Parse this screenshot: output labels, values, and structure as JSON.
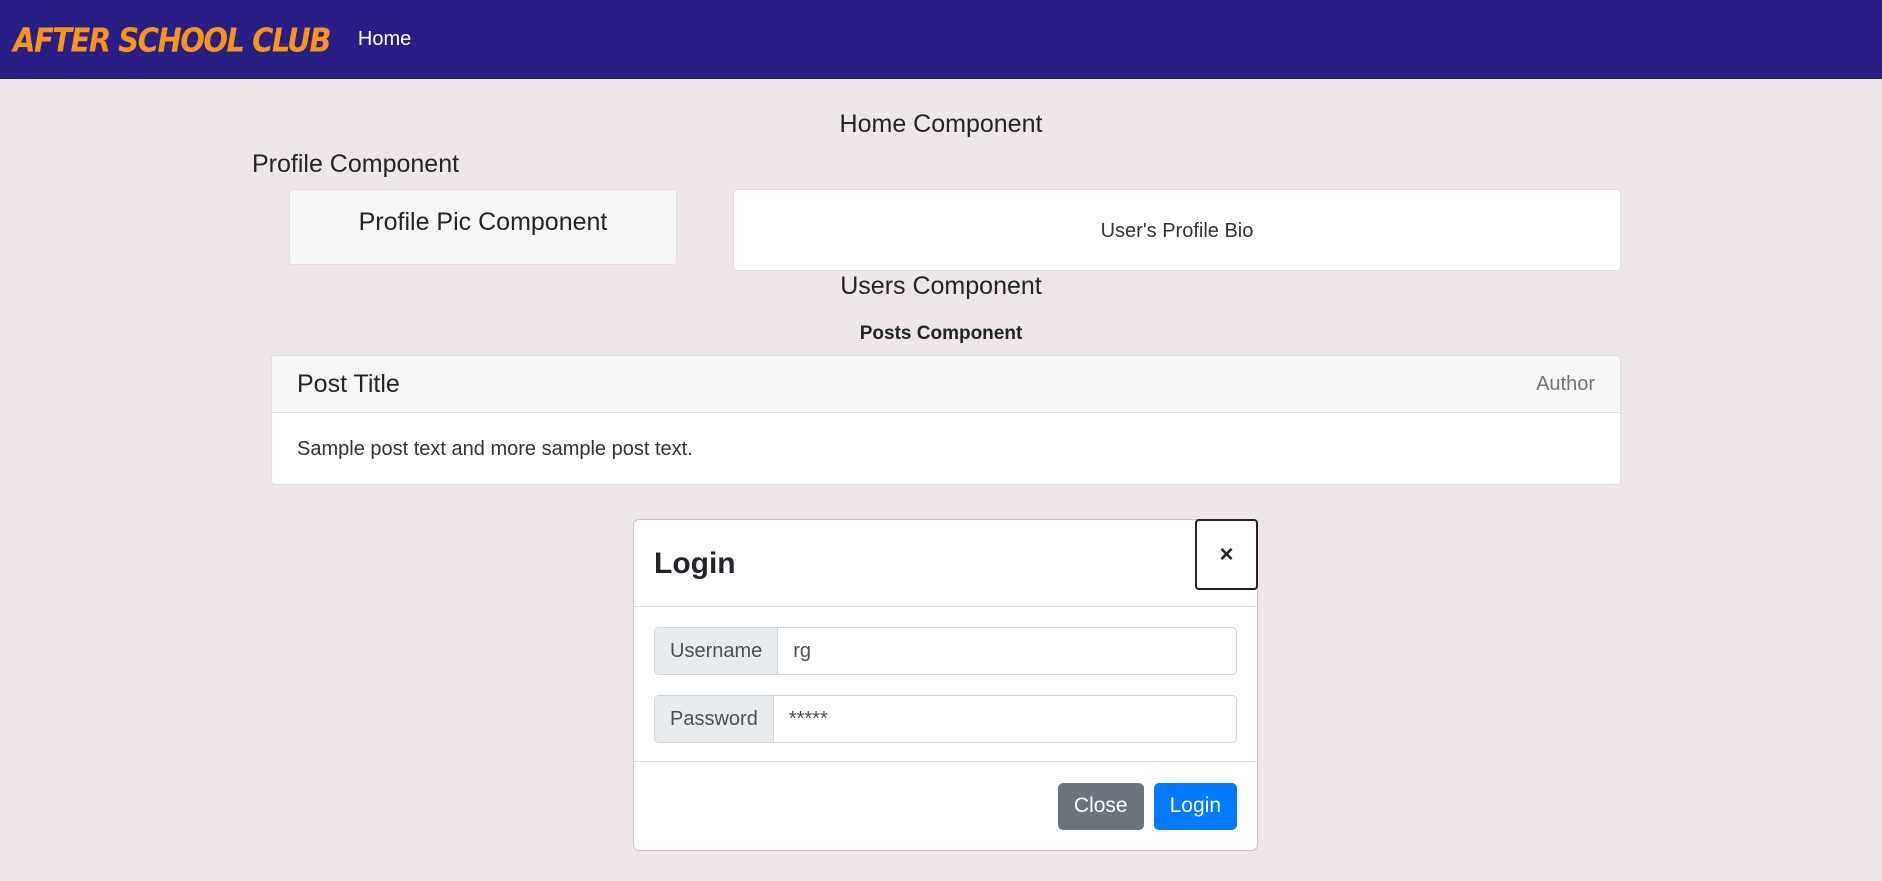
{
  "navbar": {
    "brand": "AFTER SCHOOL CLUB",
    "home_link": "Home",
    "bg_color": "#281e84",
    "brand_color": "#f7941d"
  },
  "home": {
    "title": "Home Component"
  },
  "profile": {
    "title": "Profile Component",
    "pic_label": "Profile Pic Component",
    "bio": "User's Profile Bio"
  },
  "users": {
    "title": "Users Component"
  },
  "posts": {
    "title": "Posts Component",
    "items": [
      {
        "title": "Post Title",
        "author": "Author",
        "text": "Sample post text and more sample post text."
      }
    ]
  },
  "login_modal": {
    "title": "Login",
    "close_icon": "×",
    "username_label": "Username",
    "username_value": "rg",
    "password_label": "Password",
    "password_value": "*****",
    "close_button": "Close",
    "login_button": "Login"
  }
}
